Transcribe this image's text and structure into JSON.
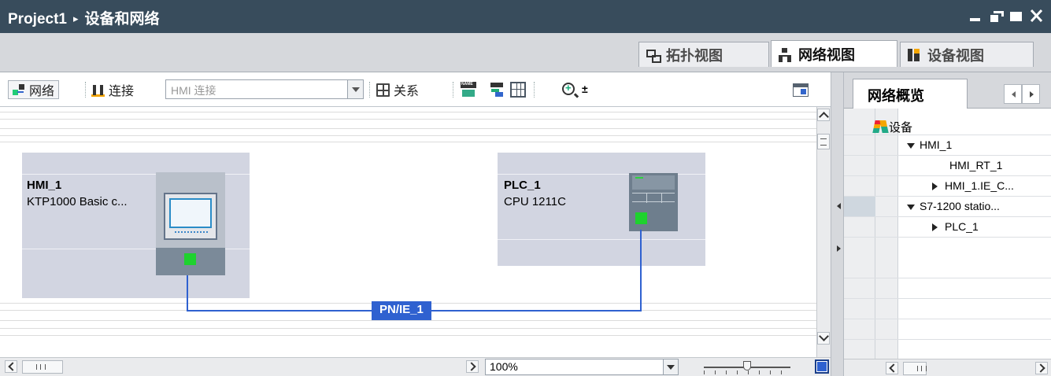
{
  "window": {
    "project": "Project1",
    "separator": "▸",
    "section": "设备和网络"
  },
  "view_tabs": [
    {
      "label": "拓扑视图",
      "icon": "topology-view-icon",
      "active": false
    },
    {
      "label": "网络视图",
      "icon": "network-view-icon",
      "active": true
    },
    {
      "label": "设备视图",
      "icon": "device-view-icon",
      "active": false
    }
  ],
  "toolbar": {
    "network_label": "网络",
    "connections_label": "连接",
    "connection_type": "HMI 连接",
    "relations_label": "关系",
    "zoom_more": "±"
  },
  "canvas": {
    "devices": [
      {
        "name": "HMI_1",
        "type": "KTP1000 Basic c..."
      },
      {
        "name": "PLC_1",
        "type": "CPU 1211C"
      }
    ],
    "network_label": "PN/IE_1",
    "port_color": "#1ed22e",
    "network_color": "#2f61d0"
  },
  "bottom": {
    "zoom_value": "100%",
    "zoom_slider_fraction": 0.5
  },
  "overview": {
    "tab_label": "网络概览",
    "column_header": "设备",
    "rows": [
      {
        "label": "HMI_1",
        "level": 1,
        "toggle": "open",
        "selected": false
      },
      {
        "label": "HMI_RT_1",
        "level": 2,
        "toggle": "none",
        "selected": false
      },
      {
        "label": "HMI_1.IE_C...",
        "level": 2,
        "toggle": "closed",
        "selected": false
      },
      {
        "label": "S7-1200 statio...",
        "level": 1,
        "toggle": "open",
        "selected": true
      },
      {
        "label": "PLC_1",
        "level": 2,
        "toggle": "closed",
        "selected": false
      }
    ]
  },
  "colors": {
    "titlebar": "#384c5c",
    "device_box": "#d2d5e1",
    "accent": "#2f61d0"
  }
}
